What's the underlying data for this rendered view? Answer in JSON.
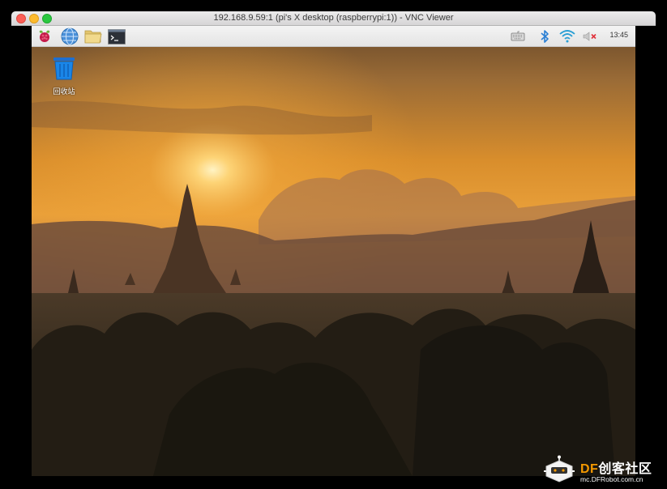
{
  "window": {
    "title": "192.168.9.59:1 (pi's X desktop (raspberrypi:1)) - VNC Viewer"
  },
  "panel": {
    "launchers": [
      "raspberry-menu-icon",
      "web-browser-icon",
      "file-manager-icon",
      "terminal-icon"
    ],
    "tray": [
      "keyboard-icon",
      "bluetooth-icon",
      "wifi-icon",
      "volume-muted-icon"
    ],
    "clock": "13:45"
  },
  "desktop": {
    "trash_label": "回收站"
  },
  "watermark": {
    "brand_prefix": "DF",
    "brand_rest": "创客社区",
    "url": "mc.DFRobot.com.cn"
  },
  "colors": {
    "panel_bg": "#e8e8e8",
    "accent_blue": "#2a7fd4",
    "brand_orange": "#f39800"
  }
}
